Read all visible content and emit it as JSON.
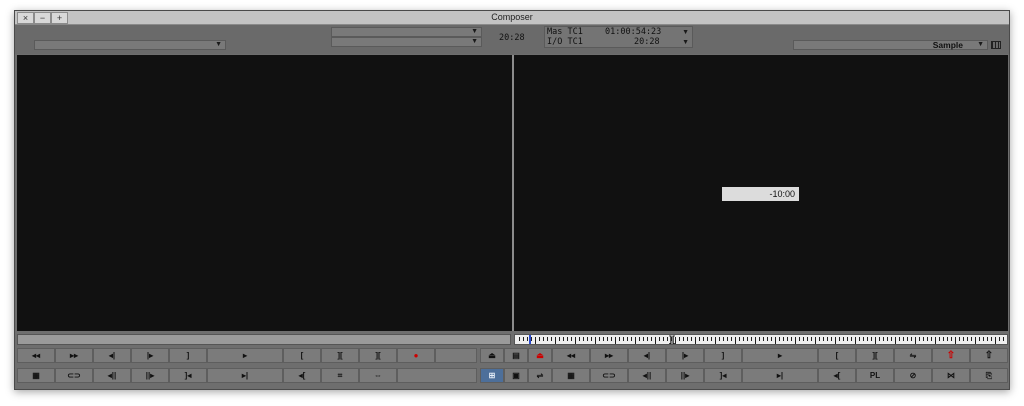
{
  "window": {
    "title": "Composer",
    "controls": {
      "close": "×",
      "minimize": "−",
      "maximize": "+"
    }
  },
  "source": {
    "clip_menu": "",
    "center_menu_1": "",
    "center_menu_2": "",
    "timecode": "20:28",
    "position": 0.0
  },
  "record": {
    "tc_row1_label": "Mas TC1",
    "tc_row1_value": "01:00:54:23",
    "tc_row2_label": "I/O TC1",
    "tc_row2_value": "20:28",
    "sequence_name": "Sample",
    "overlay_timecode": "-10:00"
  },
  "source_buttons": {
    "row1": [
      "◂◂",
      "▸▸",
      "◂|",
      "|▸",
      "]",
      "▸",
      "[",
      "][",
      "][",
      "●",
      ""
    ],
    "row2": [
      "▦",
      "⊂⊃",
      "◂||",
      "||▸",
      "]◂",
      "▸|",
      "◂[",
      "⌗",
      "⇔",
      ""
    ]
  },
  "center_buttons": {
    "row1": [
      "⏏",
      "▤",
      "⏏"
    ],
    "row2": [
      "⊞",
      "▣",
      "⇌"
    ]
  },
  "record_buttons": {
    "row1": [
      "◂◂",
      "▸▸",
      "◂|",
      "|▸",
      "]",
      "▸",
      "[",
      "][",
      "⇋",
      "⇧",
      "⇧"
    ],
    "row2": [
      "▦",
      "⊂⊃",
      "◂||",
      "||▸",
      "]◂",
      "▸|",
      "◂[",
      "PL",
      "⊘",
      "⋈",
      "⎘"
    ]
  },
  "colors": {
    "monitor_bg": "#111111",
    "panel_bg": "#6e6e6e",
    "accent_blue": "#4d6f9a",
    "red": "#cc0000"
  }
}
